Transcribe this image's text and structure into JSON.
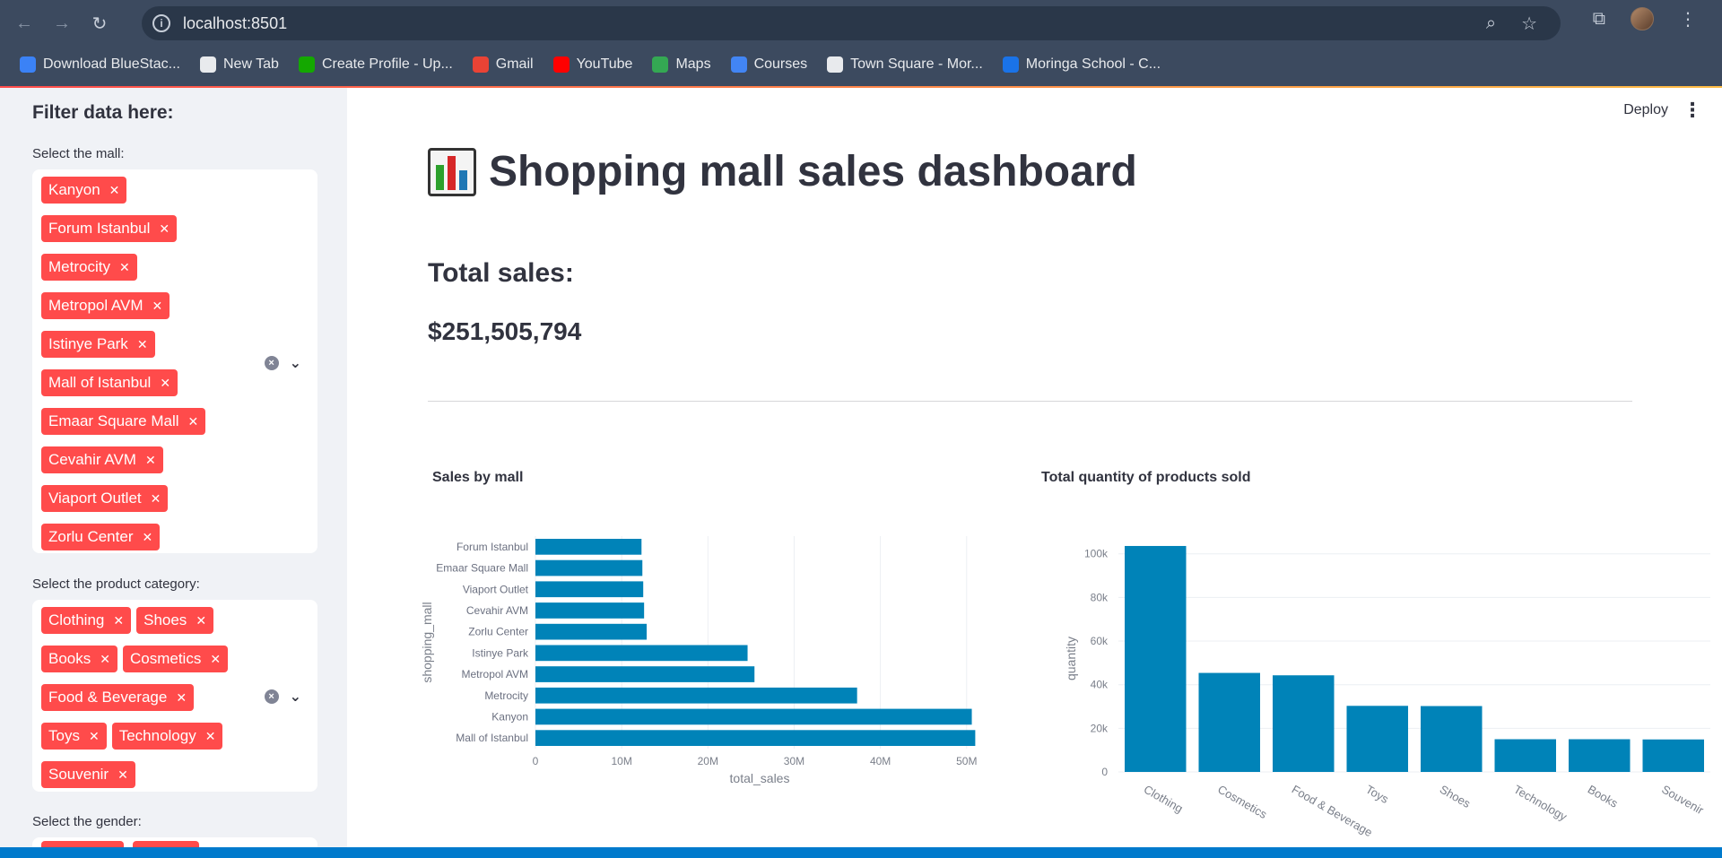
{
  "browser": {
    "url": "localhost:8501",
    "bookmarks": [
      {
        "label": "Download BlueStac...",
        "icon": "bluestacks-icon",
        "color": "#3b82f6"
      },
      {
        "label": "New Tab",
        "icon": "globe-icon",
        "color": "#e8eaed"
      },
      {
        "label": "Create Profile - Up...",
        "icon": "upwork-icon",
        "color": "#14a800"
      },
      {
        "label": "Gmail",
        "icon": "gmail-icon",
        "color": "#ea4335"
      },
      {
        "label": "YouTube",
        "icon": "youtube-icon",
        "color": "#ff0000"
      },
      {
        "label": "Maps",
        "icon": "maps-icon",
        "color": "#34a853"
      },
      {
        "label": "Courses",
        "icon": "google-icon",
        "color": "#4285f4"
      },
      {
        "label": "Town Square - Mor...",
        "icon": "townsquare-icon",
        "color": "#e8eaed"
      },
      {
        "label": "Moringa School - C...",
        "icon": "calendar-icon",
        "color": "#1a73e8"
      }
    ]
  },
  "sidebar": {
    "heading": "Filter data here:",
    "mall_label": "Select the mall:",
    "malls": [
      "Kanyon",
      "Forum Istanbul",
      "Metrocity",
      "Metropol AVM",
      "Istinye Park",
      "Mall of Istanbul",
      "Emaar Square Mall",
      "Cevahir AVM",
      "Viaport Outlet",
      "Zorlu Center"
    ],
    "category_label": "Select the product category:",
    "categories": [
      "Clothing",
      "Shoes",
      "Books",
      "Cosmetics",
      "Food & Beverage",
      "Toys",
      "Technology",
      "Souvenir"
    ],
    "gender_label": "Select the gender:"
  },
  "header": {
    "deploy": "Deploy"
  },
  "main": {
    "title": "Shopping mall sales dashboard",
    "total_sales_heading": "Total sales:",
    "total_sales_value": "$251,505,794"
  },
  "colors": {
    "accent": "#ff4b4b",
    "bar": "#0083b8"
  },
  "chart_data": [
    {
      "type": "bar",
      "orientation": "horizontal",
      "title": "Sales by mall",
      "xlabel": "total_sales",
      "ylabel": "shopping_mall",
      "categories": [
        "Forum Istanbul",
        "Emaar Square Mall",
        "Viaport Outlet",
        "Cevahir AVM",
        "Zorlu Center",
        "Istinye Park",
        "Metropol AVM",
        "Metrocity",
        "Kanyon",
        "Mall of Istanbul"
      ],
      "values": [
        12300000,
        12400000,
        12500000,
        12600000,
        12900000,
        24600000,
        25400000,
        37300000,
        50600000,
        51000000
      ],
      "xlim": [
        0,
        52000000
      ],
      "xticks": [
        "0",
        "10M",
        "20M",
        "30M",
        "40M",
        "50M"
      ],
      "grid": true
    },
    {
      "type": "bar",
      "title": "Total quantity of products sold",
      "ylabel": "quantity",
      "categories": [
        "Clothing",
        "Cosmetics",
        "Food & Beverage",
        "Toys",
        "Shoes",
        "Technology",
        "Books",
        "Souvenir"
      ],
      "values": [
        103600,
        45400,
        44300,
        30300,
        30200,
        15000,
        15000,
        14900
      ],
      "ylim": [
        0,
        104000
      ],
      "yticks": [
        "0",
        "20k",
        "40k",
        "60k",
        "80k",
        "100k"
      ],
      "grid": true
    }
  ]
}
